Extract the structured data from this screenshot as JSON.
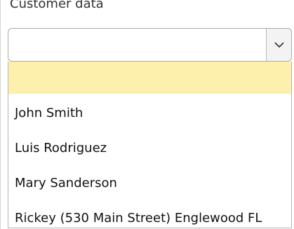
{
  "field": {
    "label": "Customer data",
    "selected_value": ""
  },
  "dropdown": {
    "highlight_color": "#fdf0ad",
    "options": [
      {
        "label": ""
      },
      {
        "label": "John Smith"
      },
      {
        "label": "Luis Rodriguez"
      },
      {
        "label": "Mary Sanderson"
      },
      {
        "label": "Rickey (530 Main Street) Englewood FL"
      }
    ]
  },
  "icons": {
    "toggle": "chevron-down-icon"
  }
}
